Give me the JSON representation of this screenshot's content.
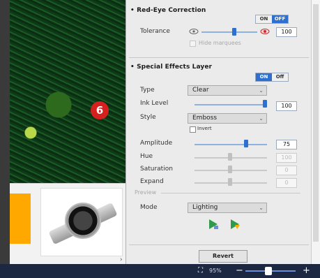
{
  "red_eye": {
    "title": "• Red-Eye Correction",
    "toggle_on": "ON",
    "toggle_off": "OFF",
    "tolerance_label": "Tolerance",
    "tolerance_value": "100",
    "tolerance_level": 0.6,
    "hide_marquees_label": "Hide marquees"
  },
  "special_effects": {
    "title": "• Special Effects Layer",
    "toggle_on": "ON",
    "toggle_off": "Off",
    "type_label": "Type",
    "type_value": "Clear",
    "ink_level_label": "Ink Level",
    "ink_level_value": "100",
    "ink_level_fraction": 1.0,
    "style_label": "Style",
    "style_value": "Emboss",
    "invert_label": "Invert",
    "amplitude_label": "Amplitude",
    "amplitude_value": "75",
    "amplitude_fraction": 0.72,
    "hue_label": "Hue",
    "hue_value": "100",
    "saturation_label": "Saturation",
    "saturation_value": "0",
    "expand_label": "Expand",
    "expand_value": "0",
    "preview_label": "Preview",
    "mode_label": "Mode",
    "mode_value": "Lighting"
  },
  "callout_number": "6",
  "revert_label": "Revert",
  "statusbar": {
    "zoom_text": "95%",
    "zoom_minus": "−",
    "zoom_plus": "+"
  },
  "colors": {
    "accent": "#2f6fcf",
    "statusbar": "#1c2742",
    "callout": "#d62020"
  }
}
